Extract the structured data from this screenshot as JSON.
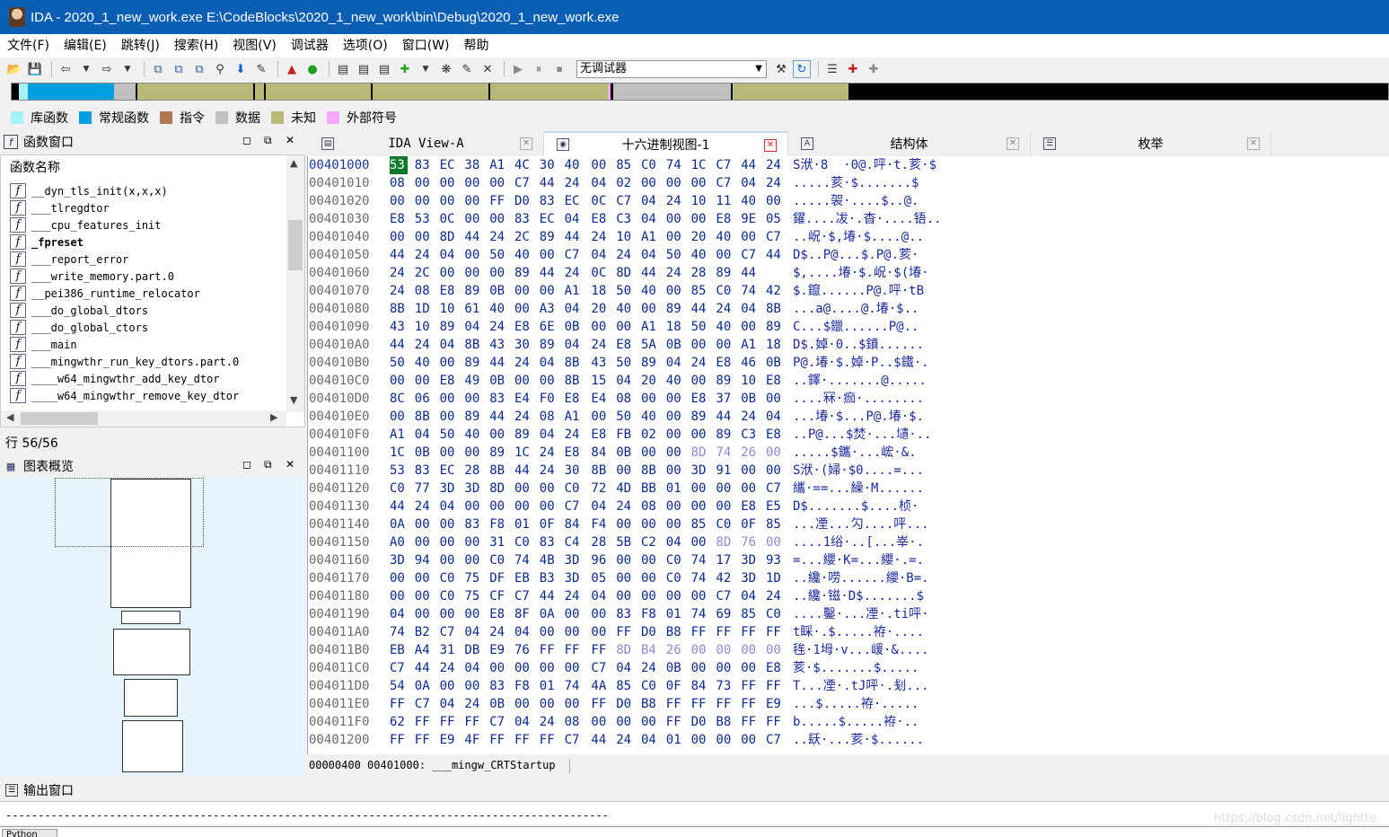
{
  "window": {
    "title": "IDA - 2020_1_new_work.exe E:\\CodeBlocks\\2020_1_new_work\\bin\\Debug\\2020_1_new_work.exe"
  },
  "menu": [
    "文件(F)",
    "编辑(E)",
    "跳转(J)",
    "搜索(H)",
    "视图(V)",
    "调试器",
    "选项(O)",
    "窗口(W)",
    "帮助"
  ],
  "toolbar": {
    "debugger_select": "无调试器",
    "icons": [
      "open-icon",
      "save-icon",
      "back-icon",
      "forward-icon",
      "copy-icon",
      "paste-icon",
      "search-icon",
      "debug-start-icon",
      "pause-icon",
      "stop-icon"
    ]
  },
  "colors": {
    "library_func": "#a8f0f8",
    "regular_func": "#00a0e0",
    "instruction": "#b07850",
    "data": "#c0c0c0",
    "unexplored": "#b8b878",
    "external_symbol": "#f8a8f8",
    "title_bar": "#0a5fb4"
  },
  "legend": [
    "库函数",
    "常规函数",
    "指令",
    "数据",
    "未知",
    "外部符号"
  ],
  "functions_panel": {
    "title": "函数窗口",
    "column": "函数名称",
    "items": [
      "__dyn_tls_init(x,x,x)",
      "___tlregdtor",
      "___cpu_features_init",
      "_fpreset",
      "___report_error",
      "___write_memory.part.0",
      "__pei386_runtime_relocator",
      "___do_global_dtors",
      "___do_global_ctors",
      "___main",
      "___mingwthr_run_key_dtors.part.0",
      "____w64_mingwthr_add_key_dtor",
      "____w64_mingwthr_remove_key_dtor"
    ],
    "row_status": "行 56/56"
  },
  "graph_panel": {
    "title": "图表概览"
  },
  "tabs": [
    {
      "label": "IDA View-A",
      "icon": "ida-view-icon"
    },
    {
      "label": "十六进制视图-1",
      "icon": "hex-view-icon"
    },
    {
      "label": "结构体",
      "icon": "struct-icon"
    },
    {
      "label": "枚举",
      "icon": "enum-icon"
    }
  ],
  "hex_rows": [
    {
      "addr": "00401000",
      "bytes": [
        "53",
        "83",
        "EC",
        "38",
        "A1",
        "4C",
        "30",
        "40",
        "00",
        "85",
        "C0",
        "74",
        "1C",
        "C7",
        "44",
        "24"
      ],
      "ascii": "S洑·8  ·0@.呯·t.荄·$"
    },
    {
      "addr": "00401010",
      "bytes": [
        "08",
        "00",
        "00",
        "00",
        "00",
        "C7",
        "44",
        "24",
        "04",
        "02",
        "00",
        "00",
        "00",
        "C7",
        "04",
        "24"
      ],
      "ascii": ".....荄·$.......$"
    },
    {
      "addr": "00401020",
      "bytes": [
        "00",
        "00",
        "00",
        "00",
        "FF",
        "D0",
        "83",
        "EC",
        "0C",
        "C7",
        "04",
        "24",
        "10",
        "11",
        "40",
        "00"
      ],
      "ascii": ".....袈·....$..@."
    },
    {
      "addr": "00401030",
      "bytes": [
        "E8",
        "53",
        "0C",
        "00",
        "00",
        "83",
        "EC",
        "04",
        "E8",
        "C3",
        "04",
        "00",
        "00",
        "E8",
        "9E",
        "05"
      ],
      "ascii": "鑃....冹·.杳·....铻.."
    },
    {
      "addr": "00401040",
      "bytes": [
        "00",
        "00",
        "8D",
        "44",
        "24",
        "2C",
        "89",
        "44",
        "24",
        "10",
        "A1",
        "00",
        "20",
        "40",
        "00",
        "C7"
      ],
      "ascii": "..岲·$,堾·$....@.."
    },
    {
      "addr": "00401050",
      "bytes": [
        "44",
        "24",
        "04",
        "00",
        "50",
        "40",
        "00",
        "C7",
        "04",
        "24",
        "04",
        "50",
        "40",
        "00",
        "C7",
        "44"
      ],
      "ascii": "D$..P@...$.P@.荄·"
    },
    {
      "addr": "00401060",
      "bytes": [
        "24",
        "2C",
        "00",
        "00",
        "00",
        "89",
        "44",
        "24",
        "0C",
        "8D",
        "44",
        "24",
        "28",
        "89",
        "44"
      ],
      "ascii": "$,....堾·$.岲·$(堾·"
    },
    {
      "addr": "00401070",
      "bytes": [
        "24",
        "08",
        "E8",
        "89",
        "0B",
        "00",
        "00",
        "A1",
        "18",
        "50",
        "40",
        "00",
        "85",
        "C0",
        "74",
        "42"
      ],
      "ascii": "$.鑹......P@.呯·tB"
    },
    {
      "addr": "00401080",
      "bytes": [
        "8B",
        "1D",
        "10",
        "61",
        "40",
        "00",
        "A3",
        "04",
        "20",
        "40",
        "00",
        "89",
        "44",
        "24",
        "04",
        "8B"
      ],
      "ascii": "...a@....@.堾·$.."
    },
    {
      "addr": "00401090",
      "bytes": [
        "43",
        "10",
        "89",
        "04",
        "24",
        "E8",
        "6E",
        "0B",
        "00",
        "00",
        "A1",
        "18",
        "50",
        "40",
        "00",
        "89"
      ],
      "ascii": "C...$鑞......P@.."
    },
    {
      "addr": "004010A0",
      "bytes": [
        "44",
        "24",
        "04",
        "8B",
        "43",
        "30",
        "89",
        "04",
        "24",
        "E8",
        "5A",
        "0B",
        "00",
        "00",
        "A1",
        "18"
      ],
      "ascii": "D$.婥·0..$鐼......"
    },
    {
      "addr": "004010B0",
      "bytes": [
        "50",
        "40",
        "00",
        "89",
        "44",
        "24",
        "04",
        "8B",
        "43",
        "50",
        "89",
        "04",
        "24",
        "E8",
        "46",
        "0B"
      ],
      "ascii": "P@.堾·$.婥·P..$鐵·."
    },
    {
      "addr": "004010C0",
      "bytes": [
        "00",
        "00",
        "E8",
        "49",
        "0B",
        "00",
        "00",
        "8B",
        "15",
        "04",
        "20",
        "40",
        "00",
        "89",
        "10",
        "E8"
      ],
      "ascii": "..鐸·.......@....."
    },
    {
      "addr": "004010D0",
      "bytes": [
        "8C",
        "06",
        "00",
        "00",
        "83",
        "E4",
        "F0",
        "E8",
        "E4",
        "08",
        "00",
        "00",
        "E8",
        "37",
        "0B",
        "00"
      ],
      "ascii": "....冧·痂·........"
    },
    {
      "addr": "004010E0",
      "bytes": [
        "00",
        "8B",
        "00",
        "89",
        "44",
        "24",
        "08",
        "A1",
        "00",
        "50",
        "40",
        "00",
        "89",
        "44",
        "24",
        "04"
      ],
      "ascii": "...堾·$...P@.堾·$."
    },
    {
      "addr": "004010F0",
      "bytes": [
        "A1",
        "04",
        "50",
        "40",
        "00",
        "89",
        "04",
        "24",
        "E8",
        "FB",
        "02",
        "00",
        "00",
        "89",
        "C3",
        "E8"
      ],
      "ascii": "..P@...$焚·...壝·.."
    },
    {
      "addr": "00401100",
      "bytes": [
        "1C",
        "0B",
        "00",
        "00",
        "89",
        "1C",
        "24",
        "E8",
        "84",
        "0B",
        "00",
        "00",
        "8D",
        "74",
        "26",
        "00"
      ],
      "ascii": ".....$鑴·...峵·&."
    },
    {
      "addr": "00401110",
      "bytes": [
        "53",
        "83",
        "EC",
        "28",
        "8B",
        "44",
        "24",
        "30",
        "8B",
        "00",
        "8B",
        "00",
        "3D",
        "91",
        "00",
        "00"
      ],
      "ascii": "S洑·(婦·$0....=..."
    },
    {
      "addr": "00401120",
      "bytes": [
        "C0",
        "77",
        "3D",
        "3D",
        "8D",
        "00",
        "00",
        "C0",
        "72",
        "4D",
        "BB",
        "01",
        "00",
        "00",
        "00",
        "C7"
      ],
      "ascii": "纗·==...繰·M......"
    },
    {
      "addr": "00401130",
      "bytes": [
        "44",
        "24",
        "04",
        "00",
        "00",
        "00",
        "00",
        "C7",
        "04",
        "24",
        "08",
        "00",
        "00",
        "00",
        "E8",
        "E5"
      ],
      "ascii": "D$.......$....桢·"
    },
    {
      "addr": "00401140",
      "bytes": [
        "0A",
        "00",
        "00",
        "83",
        "F8",
        "01",
        "0F",
        "84",
        "F4",
        "00",
        "00",
        "00",
        "85",
        "C0",
        "0F",
        "85"
      ],
      "ascii": "...凐...勽....呯..."
    },
    {
      "addr": "00401150",
      "bytes": [
        "A0",
        "00",
        "00",
        "00",
        "31",
        "C0",
        "83",
        "C4",
        "28",
        "5B",
        "C2",
        "04",
        "00",
        "8D",
        "76",
        "00"
      ],
      "ascii": "....1绤·..[...峷·."
    },
    {
      "addr": "00401160",
      "bytes": [
        "3D",
        "94",
        "00",
        "00",
        "C0",
        "74",
        "4B",
        "3D",
        "96",
        "00",
        "00",
        "C0",
        "74",
        "17",
        "3D",
        "93"
      ],
      "ascii": "=...纓·K=...纓·.=."
    },
    {
      "addr": "00401170",
      "bytes": [
        "00",
        "00",
        "C0",
        "75",
        "DF",
        "EB",
        "B3",
        "3D",
        "05",
        "00",
        "00",
        "C0",
        "74",
        "42",
        "3D",
        "1D"
      ],
      "ascii": "..纔·唠......纓·B=."
    },
    {
      "addr": "00401180",
      "bytes": [
        "00",
        "00",
        "C0",
        "75",
        "CF",
        "C7",
        "44",
        "24",
        "04",
        "00",
        "00",
        "00",
        "00",
        "C7",
        "04",
        "24"
      ],
      "ascii": "..纔·镃·D$.......$"
    },
    {
      "addr": "00401190",
      "bytes": [
        "04",
        "00",
        "00",
        "00",
        "E8",
        "8F",
        "0A",
        "00",
        "00",
        "83",
        "F8",
        "01",
        "74",
        "69",
        "85",
        "C0"
      ],
      "ascii": "....鑿·...凐·.ti呯·"
    },
    {
      "addr": "004011A0",
      "bytes": [
        "74",
        "B2",
        "C7",
        "04",
        "24",
        "04",
        "00",
        "00",
        "00",
        "FF",
        "D0",
        "B8",
        "FF",
        "FF",
        "FF",
        "FF"
      ],
      "ascii": "t睬·.$.....袸·...."
    },
    {
      "addr": "004011B0",
      "bytes": [
        "EB",
        "A4",
        "31",
        "DB",
        "E9",
        "76",
        "FF",
        "FF",
        "FF",
        "8D",
        "B4",
        "26",
        "00",
        "00",
        "00",
        "00"
      ],
      "ascii": "毪·1坶·v...嵈·&...."
    },
    {
      "addr": "004011C0",
      "bytes": [
        "C7",
        "44",
        "24",
        "04",
        "00",
        "00",
        "00",
        "00",
        "C7",
        "04",
        "24",
        "0B",
        "00",
        "00",
        "00",
        "E8"
      ],
      "ascii": "荄·$.......$....."
    },
    {
      "addr": "004011D0",
      "bytes": [
        "54",
        "0A",
        "00",
        "00",
        "83",
        "F8",
        "01",
        "74",
        "4A",
        "85",
        "C0",
        "0F",
        "84",
        "73",
        "FF",
        "FF"
      ],
      "ascii": "T...凐·.tJ呯·.刬..."
    },
    {
      "addr": "004011E0",
      "bytes": [
        "FF",
        "C7",
        "04",
        "24",
        "0B",
        "00",
        "00",
        "00",
        "FF",
        "D0",
        "B8",
        "FF",
        "FF",
        "FF",
        "FF",
        "E9"
      ],
      "ascii": "...$.....袸·....."
    },
    {
      "addr": "004011F0",
      "bytes": [
        "62",
        "FF",
        "FF",
        "FF",
        "C7",
        "04",
        "24",
        "08",
        "00",
        "00",
        "00",
        "FF",
        "D0",
        "B8",
        "FF",
        "FF"
      ],
      "ascii": "b.....$.....袸·.."
    },
    {
      "addr": "00401200",
      "bytes": [
        "FF",
        "FF",
        "E9",
        "4F",
        "FF",
        "FF",
        "FF",
        "C7",
        "44",
        "24",
        "04",
        "01",
        "00",
        "00",
        "00",
        "C7"
      ],
      "ascii": "..镺·...荄·$......"
    }
  ],
  "hex_status": {
    "offset": "00000400",
    "location": "00401000: ___mingw_CRTStartup"
  },
  "output_panel": {
    "title": "输出窗口",
    "line": "---------------------------------------------------------------------------------------------",
    "input_label": "Python"
  },
  "watermark": "https://blog.csdn.net/lightte"
}
